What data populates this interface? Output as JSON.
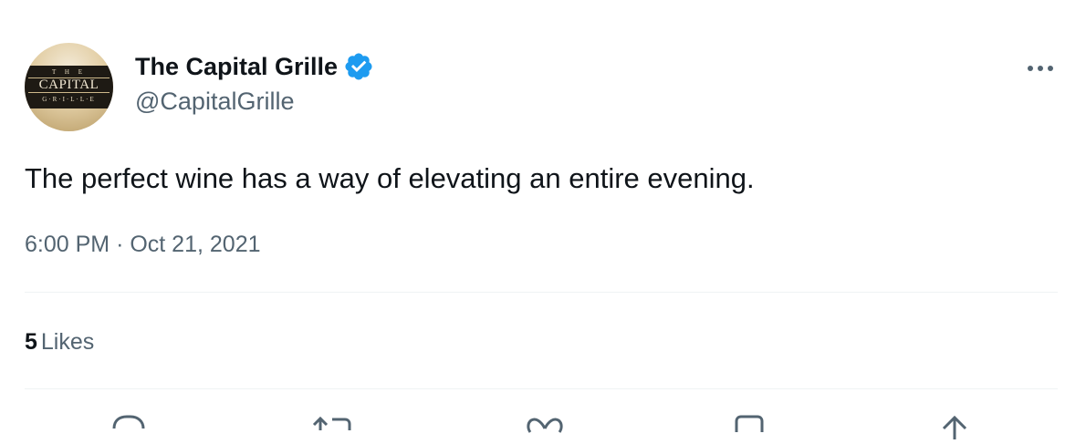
{
  "tweet": {
    "author": {
      "display_name": "The Capital Grille",
      "handle": "@CapitalGrille",
      "verified": true,
      "avatar_logo": {
        "top": "T H E",
        "middle": "CAPITAL",
        "bottom": "G·R·I·L·L·E"
      }
    },
    "more_icon": "ellipsis-icon",
    "text": "The perfect wine has a way of elevating an entire evening.",
    "time": "6:00 PM",
    "separator": "·",
    "date": "Oct 21, 2021",
    "likes": {
      "count": "5",
      "label": "Likes"
    },
    "actions": [
      "reply-icon",
      "retweet-icon",
      "like-icon",
      "bookmark-icon",
      "share-icon"
    ]
  },
  "colors": {
    "verified_blue": "#1d9bf0",
    "secondary_text": "#536471",
    "primary_text": "#0f1419",
    "divider": "#eff3f4"
  }
}
